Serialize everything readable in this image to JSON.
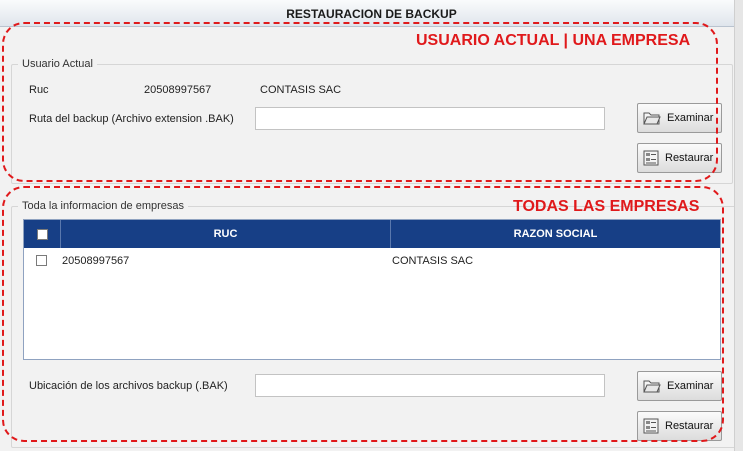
{
  "window": {
    "title": "RESTAURACION DE BACKUP"
  },
  "annotations": {
    "top_label": "USUARIO ACTUAL | UNA EMPRESA",
    "bottom_label": "TODAS LAS EMPRESAS",
    "color": "#e0191b"
  },
  "current_user": {
    "legend": "Usuario Actual",
    "ruc_label": "Ruc",
    "ruc_value": "20508997567",
    "company_name": "CONTASIS SAC",
    "backup_path_label": "Ruta del backup (Archivo extension .BAK)",
    "backup_path_value": "",
    "browse_button": "Examinar",
    "restore_button": "Restaurar"
  },
  "all_companies": {
    "legend": "Toda la informacion de empresas",
    "columns": [
      "RUC",
      "RAZON SOCIAL"
    ],
    "rows": [
      {
        "checked": false,
        "ruc": "20508997567",
        "razon_social": "CONTASIS SAC"
      }
    ],
    "location_label": "Ubicación de los archivos backup (.BAK)",
    "location_value": "",
    "browse_button": "Examinar",
    "restore_button": "Restaurar",
    "header_color": "#173f86"
  },
  "icons": {
    "browse": "folder-open-icon",
    "restore": "restore-list-icon"
  }
}
